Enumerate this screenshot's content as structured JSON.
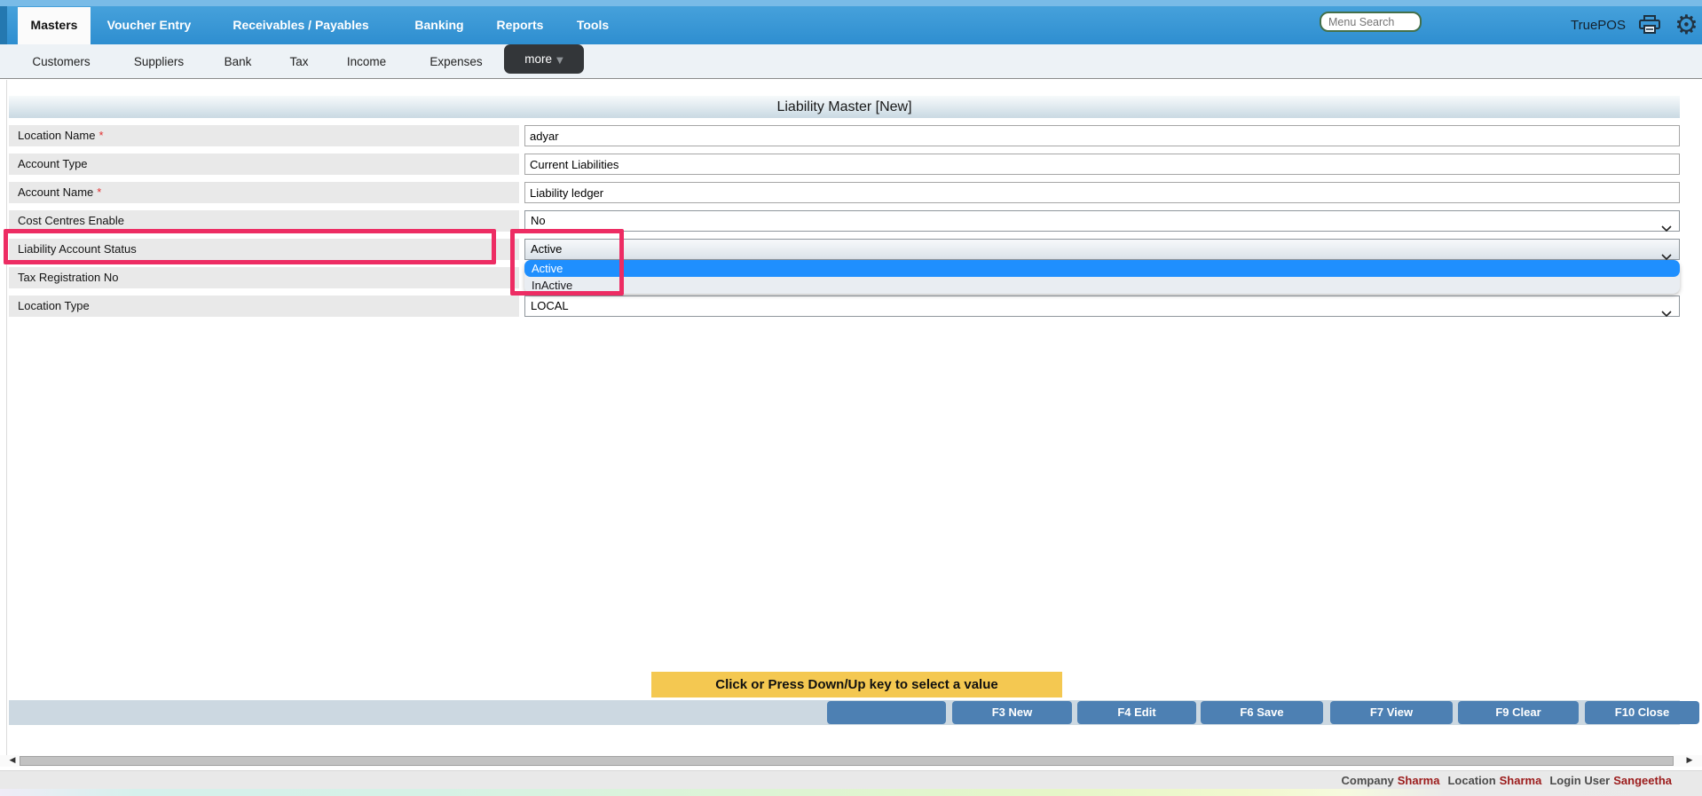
{
  "topnav": {
    "brand": "TruePOS",
    "search_placeholder": "Menu Search",
    "tabs": [
      {
        "label": "Masters",
        "active": true
      },
      {
        "label": "Voucher Entry"
      },
      {
        "label": "Receivables / Payables"
      },
      {
        "label": "Banking"
      },
      {
        "label": "Reports"
      },
      {
        "label": "Tools"
      }
    ]
  },
  "subnav": {
    "items": [
      "Customers",
      "Suppliers",
      "Bank",
      "Tax",
      "Income",
      "Expenses"
    ],
    "more_label": "more"
  },
  "page": {
    "title": "Liability Master [New]"
  },
  "form": {
    "required_marker": "*",
    "rows": [
      {
        "label": "Location Name",
        "required": true,
        "type": "input",
        "value": "adyar"
      },
      {
        "label": "Account Type",
        "required": false,
        "type": "input",
        "value": "Current Liabilities"
      },
      {
        "label": "Account Name",
        "required": true,
        "type": "input",
        "value": "Liability ledger"
      },
      {
        "label": "Cost Centres Enable",
        "required": false,
        "type": "select",
        "value": "No"
      },
      {
        "label": "Liability Account Status",
        "required": false,
        "type": "select",
        "value": "Active",
        "highlighted": true
      },
      {
        "label": "Tax Registration No",
        "required": false,
        "type": "input",
        "value": ""
      },
      {
        "label": "Location Type",
        "required": false,
        "type": "select",
        "value": "LOCAL"
      }
    ]
  },
  "dropdown": {
    "options": [
      {
        "label": "Active",
        "selected": true
      },
      {
        "label": "InActive",
        "selected": false
      }
    ]
  },
  "tooltip": {
    "text": "Click or Press Down/Up key to select a value"
  },
  "actions": {
    "buttons": [
      "",
      "F3 New",
      "F4 Edit",
      "F6 Save",
      "F7 View",
      "F9 Clear",
      "F10 Close"
    ]
  },
  "footer": {
    "company_label": "Company",
    "company": "Sharma",
    "location_label": "Location",
    "location": "Sharma",
    "user_label": "Login User",
    "user": "Sangeetha"
  },
  "colors": {
    "nav_blue": "#3093d5",
    "highlight_blue": "#1f8ffe",
    "annotation_pink": "#ed2c63",
    "tooltip_yellow": "#f4c851",
    "button_blue": "#4d80b3",
    "footer_value_red": "#9b1b1b"
  }
}
